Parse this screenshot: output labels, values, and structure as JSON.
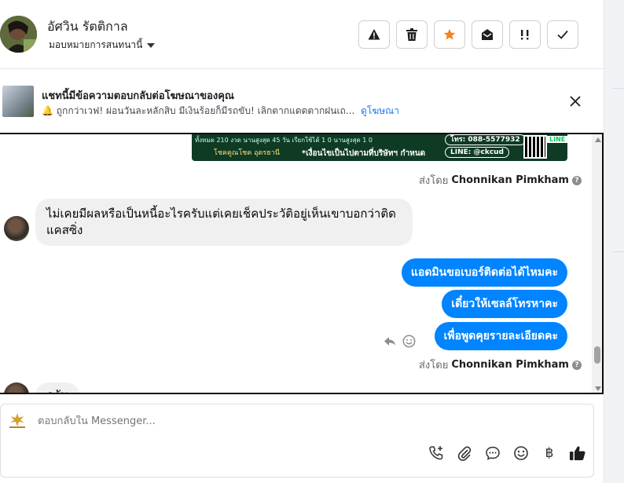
{
  "header": {
    "user_name": "อัศวิน รัตติกาล",
    "assign_label": "มอบหมายการสนทนานี้",
    "actions": [
      {
        "name": "report-spam",
        "icon": "warning-icon"
      },
      {
        "name": "delete",
        "icon": "trash-icon"
      },
      {
        "name": "star",
        "icon": "star-icon"
      },
      {
        "name": "mark-unread",
        "icon": "envelope-open-icon"
      },
      {
        "name": "follow-up",
        "icon": "exclamation-icon"
      },
      {
        "name": "mark-done",
        "icon": "check-icon"
      }
    ],
    "star_color": "#f5831f"
  },
  "ad_banner": {
    "title": "แชทนี้มีข้อความตอบกลับต่อโฆษณาของคุณ",
    "subtitle": "ถูกกว่าเวฟ! ผ่อนวันละหลักสิบ มีเงินร้อยก็มีรถขับ! เลิกตากแดดตากฝนเถ...",
    "link_label": "ดูโฆษณา"
  },
  "conversation": {
    "ad_image": {
      "phone": "โทร: 088-5577932",
      "line_id": "LINE: @ckcud",
      "line_tag": "LINE",
      "slogan": "*เงื่อนไขเป็นไปตามที่บริษัทฯ กำหนด",
      "brand": "โชคคูณโชค อุดรธานี",
      "top_line": "ทั้งหมด 210 งวด นานสูงสุด 45 วัน เรียกใช้ได้ 1 0 นานสูงสุด 1 0"
    },
    "sent_by_prefix": "ส่งโดย",
    "sent_by_name": "Chonnikan Pimkham",
    "incoming_message": "ไม่เคยมีผลหรือเป็นหนี้อะไรครับแต่เคยเช็คประวัติอยู่เห็นเขาบอกว่าติดแคสซิ่ง",
    "outgoing_messages": [
      "แอดมินขอเบอร์ติดต่อได้ไหมคะ",
      "เดี๋ยวให้เซลล์โทรหาคะ",
      "เพื่อพูดคุยรายละเอียดคะ"
    ],
    "partial_message": "ครับ",
    "bubble_out_color": "#0084ff"
  },
  "composer": {
    "placeholder": "ตอบกลับใน Messenger...",
    "tools": [
      "phone-plus-icon",
      "paperclip-icon",
      "chat-bubble-icon",
      "emoji-icon",
      "baht-icon",
      "thumbs-up-icon"
    ],
    "baht_symbol": "฿"
  }
}
